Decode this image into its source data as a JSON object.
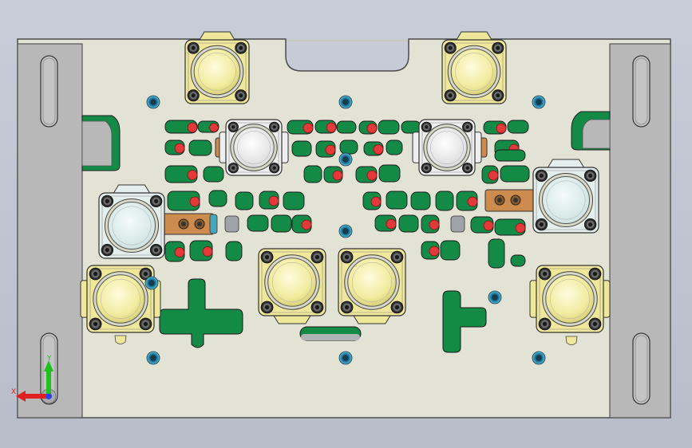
{
  "viewport": {
    "background": "#c3c7d3",
    "palette": {
      "plate": "#e2e2d5",
      "plate_edge": "#4a4a4a",
      "side_bar": "#b6b6b6",
      "pocket_green": "#138a45",
      "pocket_red": "#e23a3a",
      "punch_yellow": "#f3efad",
      "punch_white": "#f6f6f6",
      "punch_cyan": "#e6f3f1",
      "bracket_tan": "#efe79a",
      "bushing_copper": "#cd8b4e",
      "bushing_blue": "#48a6bb",
      "hole_cyan": "#3e9fc0",
      "gray_pad": "#a0a3a8"
    }
  },
  "triad": {
    "x_label": "X",
    "y_label": "Y",
    "x_color": "#e02020",
    "y_color": "#20c020",
    "z_color": "#3040e0"
  }
}
